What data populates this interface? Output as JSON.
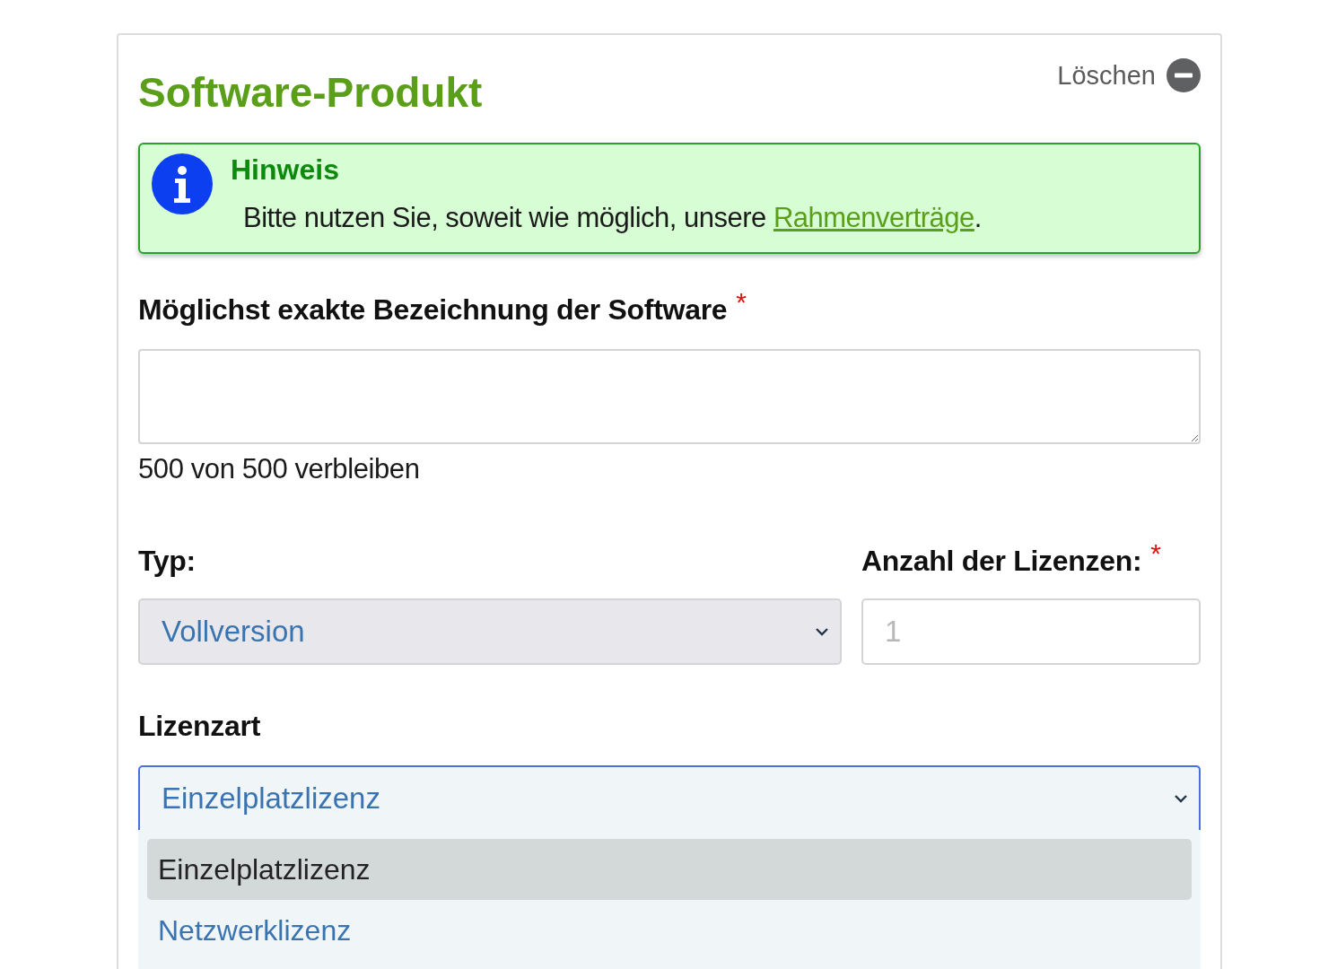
{
  "card": {
    "title": "Software-Produkt",
    "delete_button": "Löschen"
  },
  "notice": {
    "title": "Hinweis",
    "text": "Bitte nutzen Sie, soweit wie möglich, unsere ",
    "link": "Rahmenverträge",
    "text_end": "."
  },
  "fields": [
    {
      "kind": "textarea",
      "label": "Möglichst exakte Bezeichnung der Software",
      "required_mark": "*",
      "counter": "500 von 500 verbleiben"
    },
    {
      "kind": "select",
      "label": "Typ:",
      "disabled": true,
      "value": "Vollversion"
    },
    {
      "kind": "number",
      "label": "Anzahl der Lizenzen:",
      "required_mark": "*",
      "placeholder": "1"
    },
    {
      "kind": "dropdown",
      "label": "Lizenzart",
      "value": "Einzelplatzlizenz",
      "expanded": true,
      "options": [
        {
          "label": "Einzelplatzlizenz",
          "selected": true
        },
        {
          "label": "Netzwerklizenz",
          "selected": false
        }
      ]
    }
  ]
}
